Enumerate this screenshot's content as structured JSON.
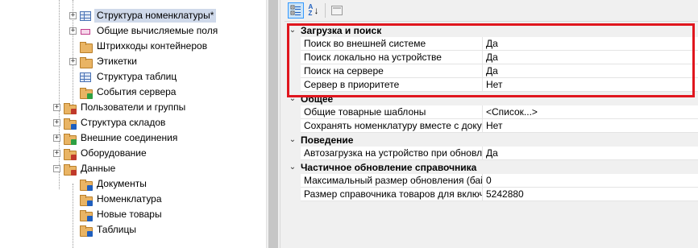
{
  "tree": {
    "items": [
      {
        "label": "Структура номенклатуры*",
        "icon": "table-icon",
        "expander": "+",
        "selected": true
      },
      {
        "label": "Общие вычисляемые поля",
        "icon": "function-icon",
        "expander": "+"
      },
      {
        "label": "Штрихкоды контейнеров",
        "icon": "folder-icon",
        "expander": ""
      },
      {
        "label": "Этикетки",
        "icon": "folder-icon",
        "expander": "+"
      },
      {
        "label": "Структура таблиц",
        "icon": "table-icon",
        "expander": ""
      },
      {
        "label": "События сервера",
        "icon": "folder-event-icon",
        "expander": ""
      },
      {
        "label": "Пользователи и группы",
        "icon": "folder-users-icon",
        "expander": "+"
      },
      {
        "label": "Структура складов",
        "icon": "folder-warehouse-icon",
        "expander": "+"
      },
      {
        "label": "Внешние соединения",
        "icon": "folder-connection-icon",
        "expander": "+"
      },
      {
        "label": "Оборудование",
        "icon": "folder-equipment-icon",
        "expander": "+"
      },
      {
        "label": "Данные",
        "icon": "folder-data-icon",
        "expander": "−"
      },
      {
        "label": "Документы",
        "icon": "folder-documents-icon",
        "expander": ""
      },
      {
        "label": "Номенклатура",
        "icon": "folder-items-icon",
        "expander": ""
      },
      {
        "label": "Новые товары",
        "icon": "folder-new-items-icon",
        "expander": ""
      },
      {
        "label": "Таблицы",
        "icon": "folder-tables-icon",
        "expander": ""
      }
    ]
  },
  "toolbar": {
    "categorized_icon": "categorized-icon",
    "alphabetical_label": "A Z",
    "property_pages_icon": "property-pages-icon"
  },
  "properties": {
    "categories": [
      {
        "label": "Загрузка и поиск",
        "rows": [
          {
            "name": "Поиск во внешней системе",
            "value": "Да"
          },
          {
            "name": "Поиск локально на устройстве",
            "value": "Да"
          },
          {
            "name": "Поиск на сервере",
            "value": "Да"
          },
          {
            "name": "Сервер в приоритете",
            "value": "Нет"
          }
        ]
      },
      {
        "label": "Общее",
        "rows": [
          {
            "name": "Общие товарные шаблоны",
            "value": "<Список...>"
          },
          {
            "name": "Сохранять номенклатуру вместе с докуме",
            "value": "Нет"
          }
        ]
      },
      {
        "label": "Поведение",
        "rows": [
          {
            "name": "Автозагрузка на устройство при обновле",
            "value": "Да"
          }
        ]
      },
      {
        "label": "Частичное обновление справочника",
        "rows": [
          {
            "name": "Максимальный размер обновления (байт)",
            "value": "0"
          },
          {
            "name": "Размер справочника товаров для включен",
            "value": "5242880"
          }
        ]
      }
    ]
  },
  "colors": {
    "highlight": "#e0161e",
    "selection": "#cfd9ea",
    "folder": "#e9b464"
  }
}
